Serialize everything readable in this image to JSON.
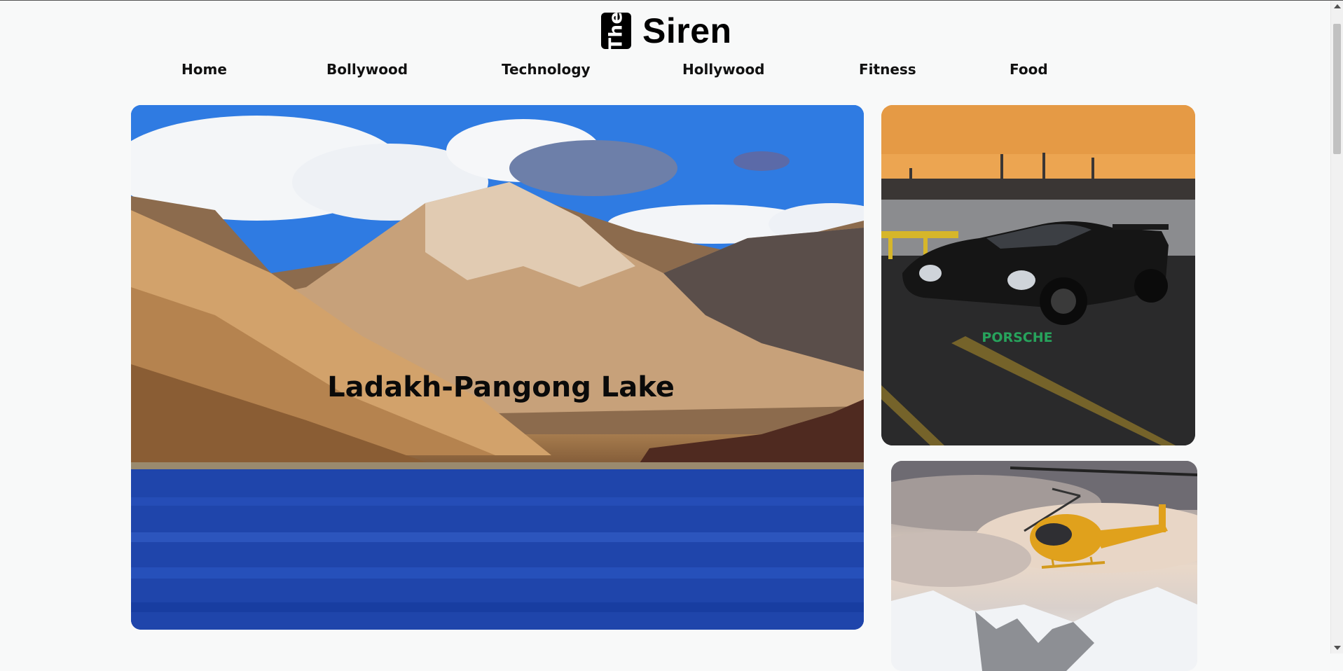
{
  "brand": {
    "mark_text": "The",
    "name": "Siren"
  },
  "nav": {
    "items": [
      {
        "label": "Home"
      },
      {
        "label": "Bollywood"
      },
      {
        "label": "Technology"
      },
      {
        "label": "Hollywood"
      },
      {
        "label": "Fitness"
      },
      {
        "label": "Food"
      }
    ]
  },
  "hero": {
    "title": "Ladakh-Pangong Lake",
    "image": "mountain-lake-photo"
  },
  "cards": {
    "car": {
      "label": "PORSCHE",
      "label_color": "#27a35c",
      "image": "black-sports-car-photo"
    },
    "helicopter": {
      "image": "yellow-helicopter-photo"
    }
  },
  "colors": {
    "background": "#f8f9f9",
    "text": "#000000"
  }
}
